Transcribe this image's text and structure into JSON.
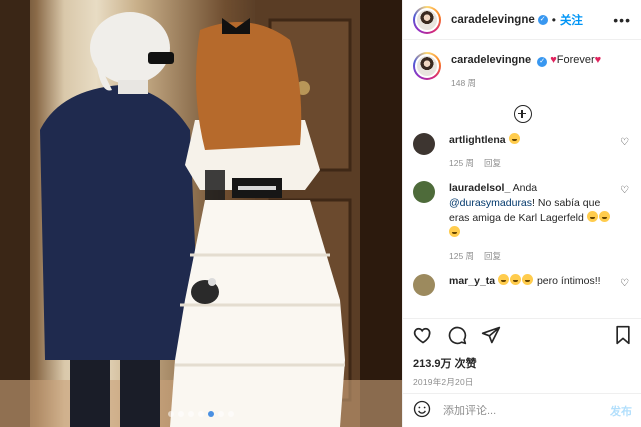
{
  "post": {
    "photo": {
      "alt": "",
      "carousel_count": 7,
      "carousel_active_index": 4
    },
    "account": {
      "username": "caradelevingne",
      "verified": true,
      "follow_label": "关注",
      "separator": "•",
      "more_icon": "more-horizontal-icon"
    },
    "caption": {
      "username": "caradelevingne",
      "text": "Forever",
      "age": "148 周"
    },
    "load_more_icon": "plus-circle-icon",
    "comments": [
      {
        "username": "artlightlena",
        "text": "",
        "emoji_count": 1,
        "age": "125 周",
        "reply_label": "回复",
        "avatar_color": "#3d3530"
      },
      {
        "username": "lauradelsol_",
        "text_prefix": "Anda",
        "mention": "@durasymaduras",
        "text": "! No sabía que eras amiga de Karl Lagerfeld",
        "emoji_count": 3,
        "age": "125 周",
        "reply_label": "回复",
        "avatar_color": "#4e6b3a"
      },
      {
        "username": "mar_y_ta",
        "text": "pero íntimos!!",
        "emoji_count": 3,
        "age": "",
        "reply_label": "",
        "avatar_color": "#9c8a5e"
      }
    ],
    "likes": "213.9万 次赞",
    "date": "2019年2月20日",
    "add_comment": {
      "placeholder": "添加评论...",
      "post_label": "发布"
    },
    "colors": {
      "accent": "#0095f6",
      "verified": "#3897f0",
      "heart": "#e0245e",
      "muted": "#8e8e8e"
    }
  }
}
